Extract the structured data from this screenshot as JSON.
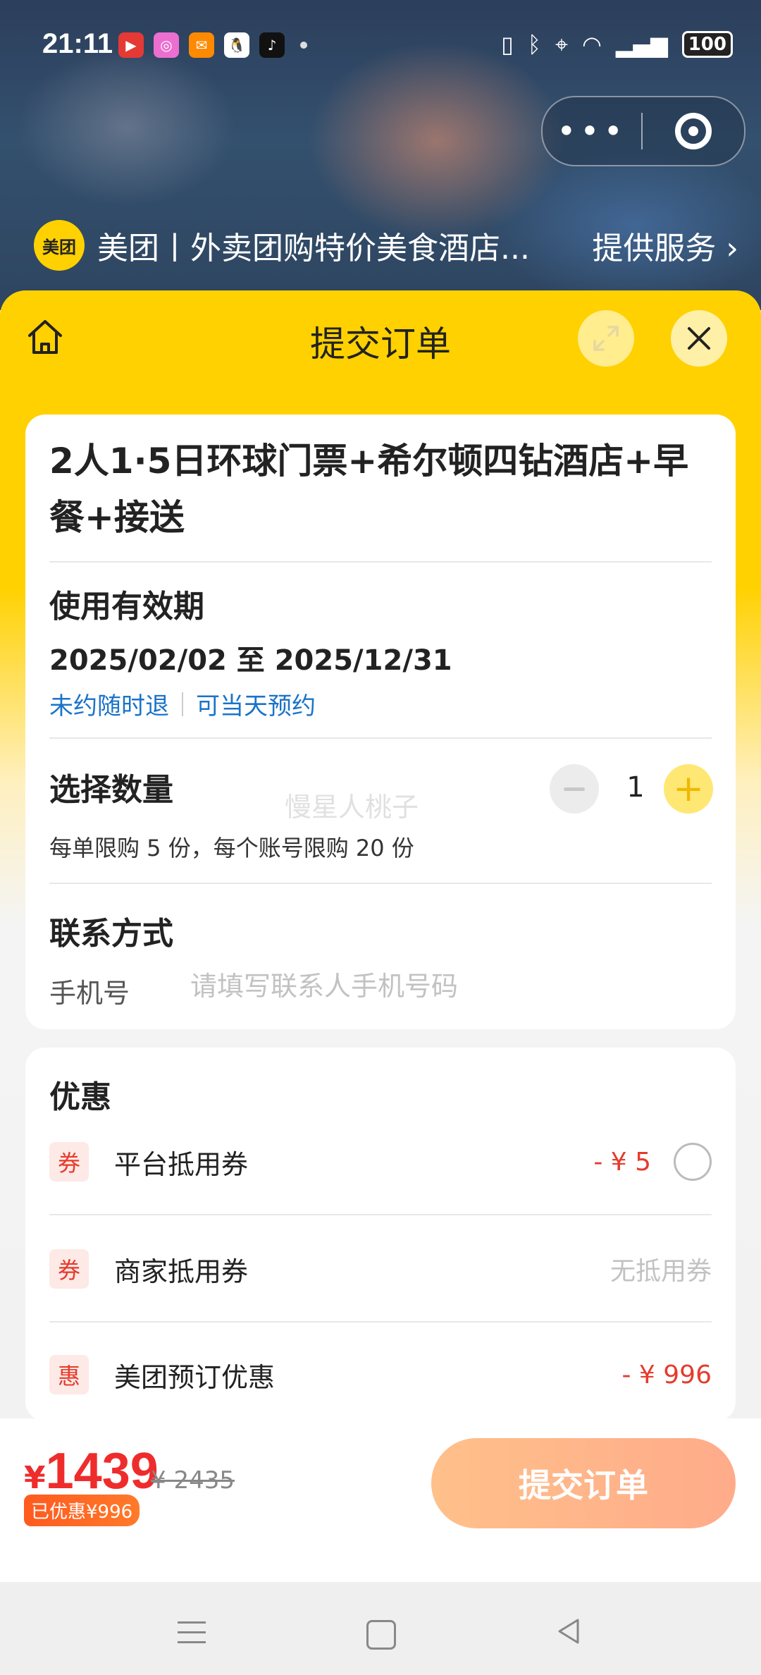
{
  "status_bar": {
    "time": "21:11",
    "battery": "100",
    "apps": [
      "video-app-icon",
      "camera-app-icon",
      "mail-app-icon",
      "qq-app-icon",
      "tiktok-app-icon"
    ]
  },
  "mini_program": {
    "logo_text": "美团",
    "title": "美团丨外卖团购特价美食酒店...",
    "service_link": "提供服务"
  },
  "sheet": {
    "title": "提交订单"
  },
  "product": {
    "title": "2人1·5日环球门票+希尔顿四钻酒店+早餐+接送",
    "validity_label": "使用有效期",
    "validity_dates": "2025/02/02 至 2025/12/31",
    "policies": [
      "未约随时退",
      "可当天预约"
    ]
  },
  "quantity": {
    "label": "选择数量",
    "value": "1",
    "limit_text": "每单限购 5 份，每个账号限购 20 份",
    "watermark": "慢星人桃子"
  },
  "contact": {
    "label": "联系方式",
    "phone_label": "手机号",
    "phone_placeholder": "请填写联系人手机号码",
    "phone_value": ""
  },
  "discounts": {
    "title": "优惠",
    "items": [
      {
        "badge": "券",
        "label": "平台抵用券",
        "amount": "- ¥ 5"
      },
      {
        "badge": "券",
        "label": "商家抵用券",
        "amount": "无抵用券"
      },
      {
        "badge": "惠",
        "label": "美团预订优惠",
        "amount": "- ¥ 996"
      }
    ]
  },
  "checkout": {
    "currency": "¥",
    "price": "1439",
    "original_price": "¥ 2435",
    "saved_badge": "已优惠¥996",
    "submit_label": "提交订单"
  },
  "colors": {
    "brand_yellow": "#ffd100",
    "price_red": "#ef2c2c",
    "link_blue": "#1a73c8",
    "submit_gradient_start": "#ffc08a",
    "submit_gradient_end": "#ffab8a"
  }
}
